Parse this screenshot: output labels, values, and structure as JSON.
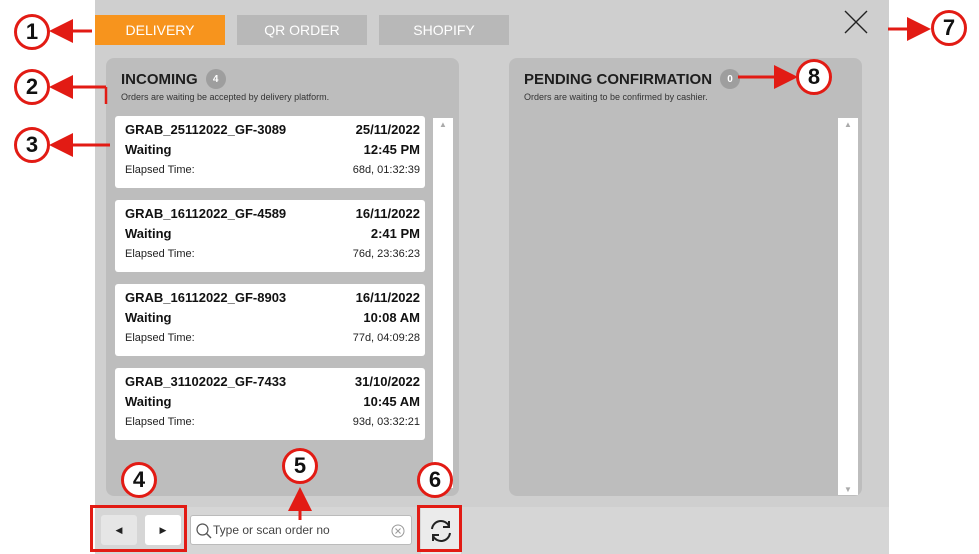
{
  "tabs": [
    {
      "label": "DELIVERY",
      "active": true
    },
    {
      "label": "QR ORDER",
      "active": false
    },
    {
      "label": "SHOPIFY",
      "active": false
    }
  ],
  "incoming": {
    "title": "INCOMING",
    "count": "4",
    "subtitle": "Orders are waiting be accepted by delivery platform.",
    "orders": [
      {
        "id": "GRAB_25112022_GF-3089",
        "date": "25/11/2022",
        "status": "Waiting",
        "time": "12:45 PM",
        "elapsed_label": "Elapsed Time:",
        "elapsed": "68d, 01:32:39"
      },
      {
        "id": "GRAB_16112022_GF-4589",
        "date": "16/11/2022",
        "status": "Waiting",
        "time": "2:41 PM",
        "elapsed_label": "Elapsed Time:",
        "elapsed": "76d, 23:36:23"
      },
      {
        "id": "GRAB_16112022_GF-8903",
        "date": "16/11/2022",
        "status": "Waiting",
        "time": "10:08 AM",
        "elapsed_label": "Elapsed Time:",
        "elapsed": "77d, 04:09:28"
      },
      {
        "id": "GRAB_31102022_GF-7433",
        "date": "31/10/2022",
        "status": "Waiting",
        "time": "10:45 AM",
        "elapsed_label": "Elapsed Time:",
        "elapsed": "93d, 03:32:21"
      }
    ]
  },
  "pending": {
    "title": "PENDING CONFIRMATION",
    "count": "0",
    "subtitle": "Orders are waiting to be confirmed by cashier."
  },
  "search": {
    "placeholder": "Type or scan order no"
  },
  "annotations": [
    "1",
    "2",
    "3",
    "4",
    "5",
    "6",
    "7",
    "8"
  ],
  "colors": {
    "accent": "#f7941d",
    "annotation": "#e21b14"
  },
  "icons": {
    "close": "close-icon",
    "search": "search-icon",
    "clear": "clear-icon",
    "refresh": "refresh-icon",
    "prev": "caret-left-icon",
    "next": "caret-right-icon"
  }
}
